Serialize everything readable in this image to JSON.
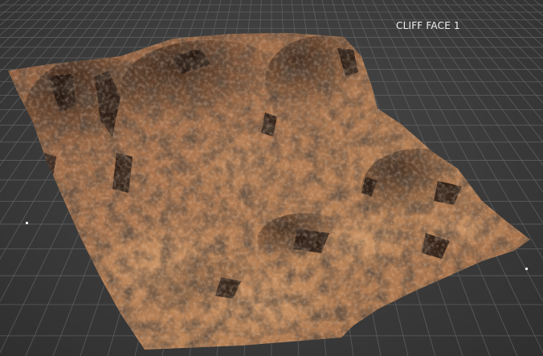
{
  "viewport": {
    "label": "CLIFF FACE 1",
    "background_color": "#3b3b3b",
    "grid_color": "#6a6a6a",
    "terrain_base_color": "#b07a52",
    "terrain_shadow_color": "#2a1d16",
    "marker_icon": "vertex-marker-icon"
  }
}
